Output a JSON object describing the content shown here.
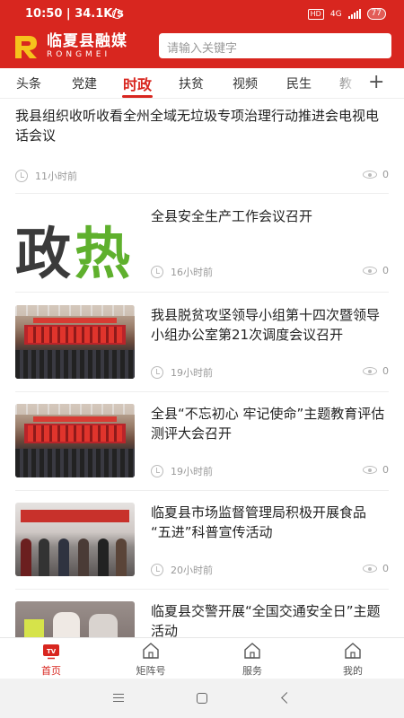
{
  "status_bar": {
    "time": "10:50",
    "speed": "34.1K/s",
    "hd": "HD",
    "network": "4G",
    "battery": "77"
  },
  "header": {
    "brand_cn": "临夏县融媒",
    "brand_en": "RONGMEI",
    "search_placeholder": "请输入关键字",
    "brand_color": "#d8261f"
  },
  "tabs": [
    {
      "label": "头条"
    },
    {
      "label": "党建"
    },
    {
      "label": "时政",
      "active": true
    },
    {
      "label": "扶贫"
    },
    {
      "label": "视频"
    },
    {
      "label": "民生"
    },
    {
      "label": "教"
    }
  ],
  "tab_add_icon": "plus-icon",
  "feed": [
    {
      "title": "我县组织收听收看全州全域无垃圾专项治理行动推进会电视电话会议",
      "time": "11小时前",
      "views": "0",
      "thumb": null
    },
    {
      "title": "全县安全生产工作会议召开",
      "time": "16小时前",
      "views": "0",
      "thumb": "政热"
    },
    {
      "title": "我县脱贫攻坚领导小组第十四次暨领导小组办公室第21次调度会议召开",
      "time": "19小时前",
      "views": "0",
      "thumb": "meeting-hall-photo"
    },
    {
      "title": "全县“不忘初心 牢记使命”主题教育评估测评大会召开",
      "time": "19小时前",
      "views": "0",
      "thumb": "meeting-hall-photo"
    },
    {
      "title": "临夏县市场监督管理局积极开展食品 “五进”科普宣传活动",
      "time": "20小时前",
      "views": "0",
      "thumb": "outdoor-event-photo"
    },
    {
      "title": "临夏县交警开展“全国交通安全日”主题活动",
      "time": "",
      "views": "",
      "thumb": "traffic-police-photo"
    }
  ],
  "bottom_nav": [
    {
      "label": "首页",
      "icon": "tv-icon",
      "active": true
    },
    {
      "label": "矩阵号",
      "icon": "home-icon"
    },
    {
      "label": "服务",
      "icon": "home-icon"
    },
    {
      "label": "我的",
      "icon": "home-icon"
    }
  ],
  "system_nav": [
    "menu-icon",
    "home-square-icon",
    "back-icon"
  ]
}
